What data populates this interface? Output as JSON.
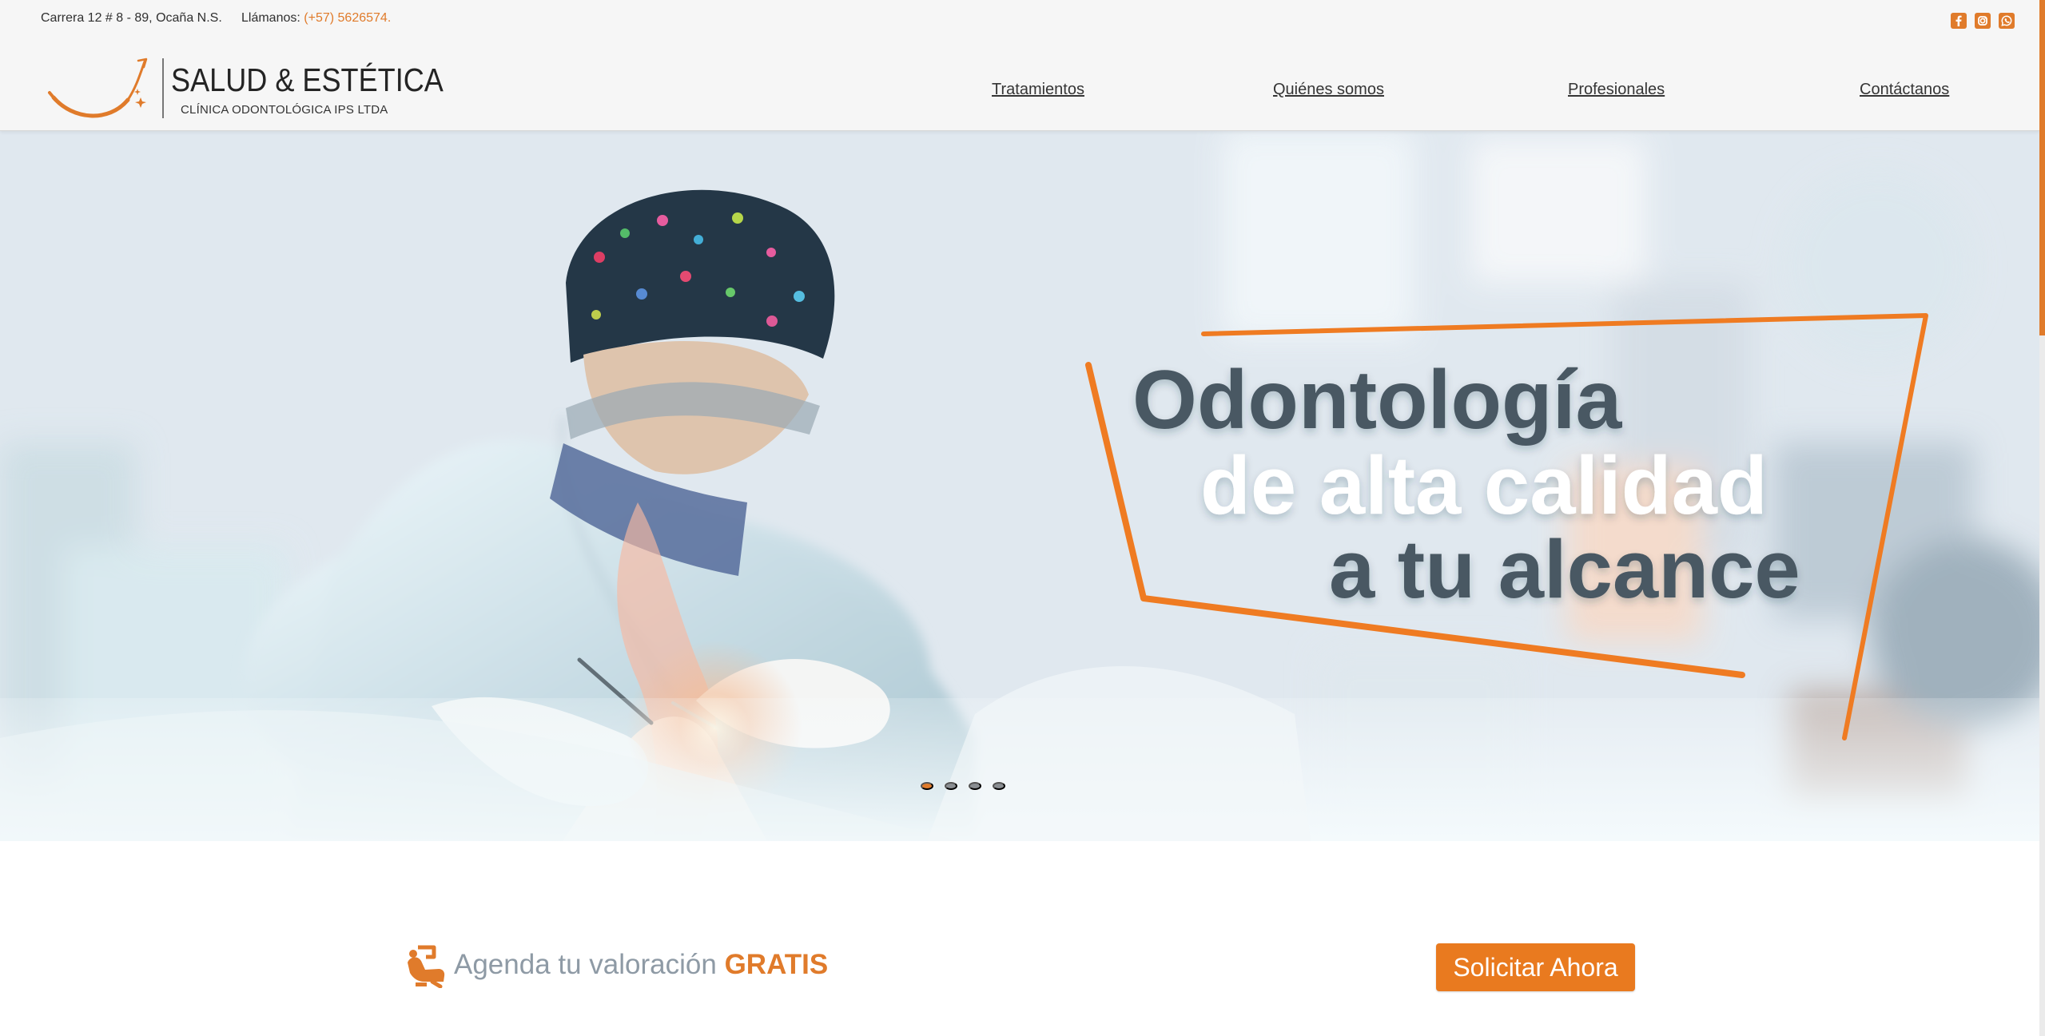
{
  "header": {
    "address": "Carrera 12 # 8 - 89, Ocaña N.S.",
    "phone_label": "Llámanos:",
    "phone_number": "(+57) 5626574.",
    "social_icons": [
      "facebook-icon",
      "instagram-icon",
      "whatsapp-icon"
    ],
    "accent_color": "#e07b2b"
  },
  "logo": {
    "name": "SALUD & ESTÉTICA",
    "subtitle": "CLÍNICA ODONTOLÓGICA IPS LTDA"
  },
  "nav": {
    "items": [
      {
        "label": "Tratamientos"
      },
      {
        "label": "Quiénes somos"
      },
      {
        "label": "Profesionales"
      },
      {
        "label": "Contáctanos"
      }
    ]
  },
  "hero": {
    "headline_line_1": "Odontología",
    "headline_line_2": "de alta calidad",
    "headline_line_3": "a tu alcance",
    "slides": [
      {
        "active": true
      },
      {
        "active": false
      },
      {
        "active": false
      },
      {
        "active": false
      }
    ]
  },
  "appointment": {
    "text": "Agenda tu valoración",
    "highlight": "GRATIS",
    "button_label": "Solicitar Ahora"
  }
}
